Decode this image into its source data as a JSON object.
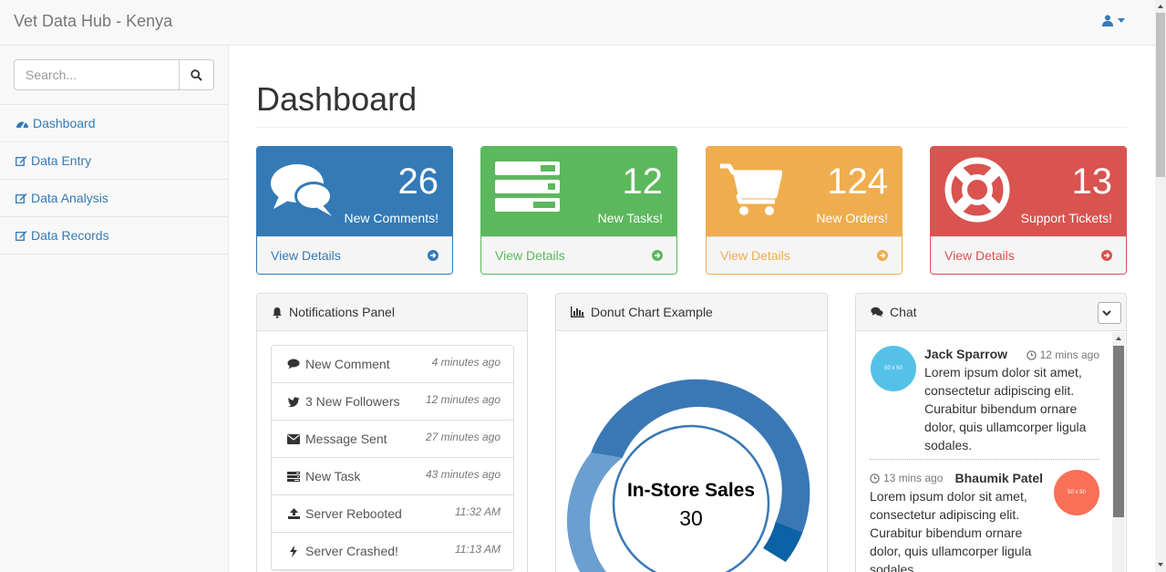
{
  "app": {
    "brand": "Vet Data Hub - Kenya"
  },
  "sidebar": {
    "search_placeholder": "Search...",
    "items": [
      {
        "label": "Dashboard",
        "icon": "dashboard-icon"
      },
      {
        "label": "Data Entry",
        "icon": "edit-icon"
      },
      {
        "label": "Data Analysis",
        "icon": "edit-icon"
      },
      {
        "label": "Data Records",
        "icon": "edit-icon"
      }
    ]
  },
  "page": {
    "title": "Dashboard"
  },
  "stats": [
    {
      "value": "26",
      "label": "New Comments!",
      "link": "View Details",
      "color": "#337ab7",
      "icon": "comments-icon"
    },
    {
      "value": "12",
      "label": "New Tasks!",
      "link": "View Details",
      "color": "#5cb85c",
      "icon": "tasks-icon"
    },
    {
      "value": "124",
      "label": "New Orders!",
      "link": "View Details",
      "color": "#f0ad4e",
      "icon": "shopping-cart-icon"
    },
    {
      "value": "13",
      "label": "Support Tickets!",
      "link": "View Details",
      "color": "#d9534f",
      "icon": "support-icon"
    }
  ],
  "notifications": {
    "title": "Notifications Panel",
    "items": [
      {
        "text": "New Comment",
        "time": "4 minutes ago",
        "icon": "comment-icon"
      },
      {
        "text": "3 New Followers",
        "time": "12 minutes ago",
        "icon": "twitter-icon"
      },
      {
        "text": "Message Sent",
        "time": "27 minutes ago",
        "icon": "envelope-icon"
      },
      {
        "text": "New Task",
        "time": "43 minutes ago",
        "icon": "tasks-icon"
      },
      {
        "text": "Server Rebooted",
        "time": "11:32 AM",
        "icon": "upload-icon"
      },
      {
        "text": "Server Crashed!",
        "time": "11:13 AM",
        "icon": "bolt-icon"
      }
    ]
  },
  "donut": {
    "title": "Donut Chart Example",
    "center_label": "In-Store Sales",
    "center_value": "30"
  },
  "chart_data": {
    "type": "pie",
    "title": "",
    "center_label": "In-Store Sales",
    "center_value": 30,
    "colors": [
      "#3a78b5",
      "#0b62a4",
      "#6a9fcf"
    ]
  },
  "chat": {
    "title": "Chat",
    "messages": [
      {
        "name": "Jack Sparrow",
        "time": "12 mins ago",
        "text": "Lorem ipsum dolor sit amet, consectetur adipiscing elit. Curabitur bibendum ornare dolor, quis ullamcorper ligula sodales.",
        "avatar_text": "50 x 50",
        "avatar_color": "#55c1e7"
      },
      {
        "name": "Bhaumik Patel",
        "time": "13 mins ago",
        "text": "Lorem ipsum dolor sit amet, consectetur adipiscing elit. Curabitur bibendum ornare dolor, quis ullamcorper ligula sodales.",
        "avatar_text": "50 x 50",
        "avatar_color": "#fa6f57"
      }
    ]
  }
}
